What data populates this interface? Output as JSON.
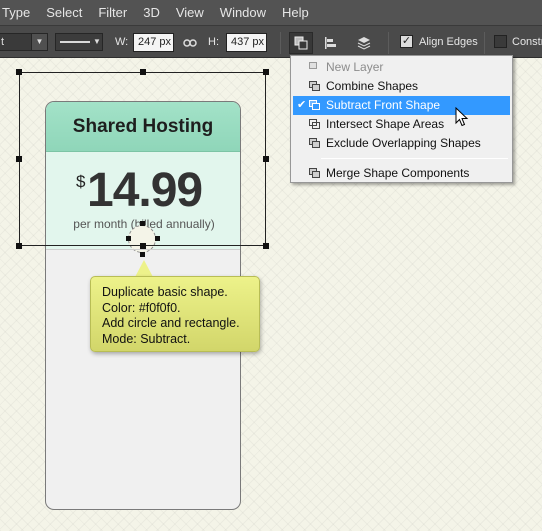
{
  "menubar": {
    "items": [
      "Type",
      "Select",
      "Filter",
      "3D",
      "View",
      "Window",
      "Help"
    ]
  },
  "options": {
    "path_mode_value": "t",
    "width_label": "W:",
    "width_value": "247 px",
    "height_label": "H:",
    "height_value": "437 px",
    "align_edges_label": "Align Edges",
    "constrain_label": "Constra",
    "icons": [
      "link-icon",
      "path-operations-icon",
      "path-alignment-icon",
      "path-arrangement-icon"
    ]
  },
  "menu": {
    "items": [
      {
        "label": "New Layer",
        "disabled": true
      },
      {
        "label": "Combine Shapes"
      },
      {
        "label": "Subtract Front Shape",
        "selected": true,
        "checked": true
      },
      {
        "label": "Intersect Shape Areas"
      },
      {
        "label": "Exclude Overlapping Shapes"
      }
    ],
    "merge_label": "Merge Shape Components",
    "highlight_color": "#3399ff"
  },
  "card": {
    "title": "Shared Hosting",
    "currency": "$",
    "price": "14.99",
    "period": "per month (billed annually)",
    "header_color": "#9adcc1",
    "body_color": "#f0f0f0"
  },
  "tooltip": {
    "lines": [
      "Duplicate basic shape.",
      "Color: #f0f0f0.",
      "Add circle and rectangle.",
      "Mode: Subtract."
    ]
  }
}
